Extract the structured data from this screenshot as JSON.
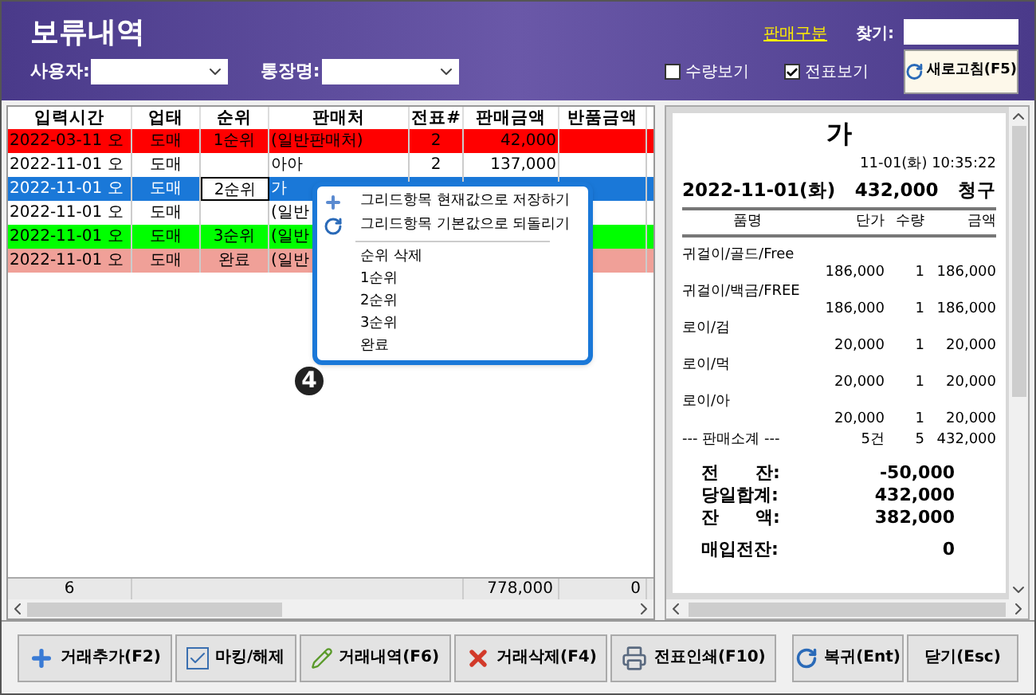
{
  "window": {
    "title": "보류내역"
  },
  "header": {
    "sales_link": "판매구분",
    "search_label": "찾기:",
    "user_label": "사용자:",
    "account_label": "통장명:",
    "checkboxes": [
      {
        "label": "수량보기",
        "checked": false
      },
      {
        "label": "전표보기",
        "checked": true
      }
    ],
    "refresh_button": "새로고침(F5)"
  },
  "table": {
    "columns": [
      "입력시간",
      "업태",
      "순위",
      "판매처",
      "전표#",
      "판매금액",
      "반품금액"
    ],
    "rows": [
      {
        "cells": [
          "2022-03-11 오",
          "도매",
          "1순위",
          "(일반판매처)",
          "2",
          "42,000",
          ""
        ],
        "color": "#ff0000",
        "selected": false
      },
      {
        "cells": [
          "2022-11-01 오",
          "도매",
          "",
          "아아",
          "2",
          "137,000",
          ""
        ],
        "color": "#ffffff",
        "selected": false
      },
      {
        "cells": [
          "2022-11-01 오",
          "도매",
          "2순위",
          "가",
          "",
          "",
          ""
        ],
        "selected": true
      },
      {
        "cells": [
          "2022-11-01 오",
          "도매",
          "",
          "(일반",
          "",
          "",
          ""
        ],
        "color": "#ffffff",
        "selected": false
      },
      {
        "cells": [
          "2022-11-01 오",
          "도매",
          "3순위",
          "(일반",
          "",
          "",
          ""
        ],
        "color": "#00ff00",
        "selected": false
      },
      {
        "cells": [
          "2022-11-01 오",
          "도매",
          "완료",
          "(일반",
          "",
          "",
          ""
        ],
        "color": "#f0a098",
        "selected": false
      }
    ],
    "totals": {
      "count": "6",
      "sales": "778,000",
      "returns": "0"
    }
  },
  "context_menu": {
    "items": [
      {
        "kind": "save",
        "label": "그리드항목 현재값으로 저장하기"
      },
      {
        "kind": "reset",
        "label": "그리드항목 기본값으로 되돌리기"
      },
      {
        "kind": "separator"
      },
      {
        "kind": "plain",
        "label": "순위 삭제"
      },
      {
        "kind": "plain",
        "label": "1순위"
      },
      {
        "kind": "plain",
        "label": "2순위"
      },
      {
        "kind": "plain",
        "label": "3순위"
      },
      {
        "kind": "plain",
        "label": "완료"
      }
    ],
    "marker": "4"
  },
  "receipt": {
    "customer": "가",
    "timestamp": "11-01(화) 10:35:22",
    "date": "2022-11-01(화)",
    "total": "432,000",
    "type": "청구",
    "columns": [
      "품명",
      "단가",
      "수량",
      "금액"
    ],
    "items": [
      {
        "name": "귀걸이/골드/Free",
        "price": "186,000",
        "qty": "1",
        "amount": "186,000"
      },
      {
        "name": "귀걸이/백금/FREE",
        "price": "186,000",
        "qty": "1",
        "amount": "186,000"
      },
      {
        "name": "로이/검",
        "price": "20,000",
        "qty": "1",
        "amount": "20,000"
      },
      {
        "name": "로이/먹",
        "price": "20,000",
        "qty": "1",
        "amount": "20,000"
      },
      {
        "name": "로이/아",
        "price": "20,000",
        "qty": "1",
        "amount": "20,000"
      }
    ],
    "subtotal": {
      "label": "--- 판매소계 ---",
      "count": "5건",
      "qty": "5",
      "amount": "432,000"
    },
    "summary": [
      {
        "label": "전      잔:",
        "value": "-50,000"
      },
      {
        "label": "당일합계:",
        "value": "432,000"
      },
      {
        "label": "잔      액:",
        "value": "382,000"
      },
      {
        "label": "매입전잔:",
        "value": "0"
      }
    ]
  },
  "footer_buttons": [
    {
      "kind": "add",
      "label": "거래추가(F2)"
    },
    {
      "kind": "mark",
      "label": "마킹/해제"
    },
    {
      "kind": "history",
      "label": "거래내역(F6)"
    },
    {
      "kind": "delete",
      "label": "거래삭제(F4)"
    },
    {
      "kind": "print",
      "label": "전표인쇄(F10)"
    }
  ],
  "right_buttons": [
    {
      "kind": "back",
      "label": "복귀(Ent)"
    },
    {
      "kind": "close",
      "label": "닫기(Esc)"
    }
  ]
}
